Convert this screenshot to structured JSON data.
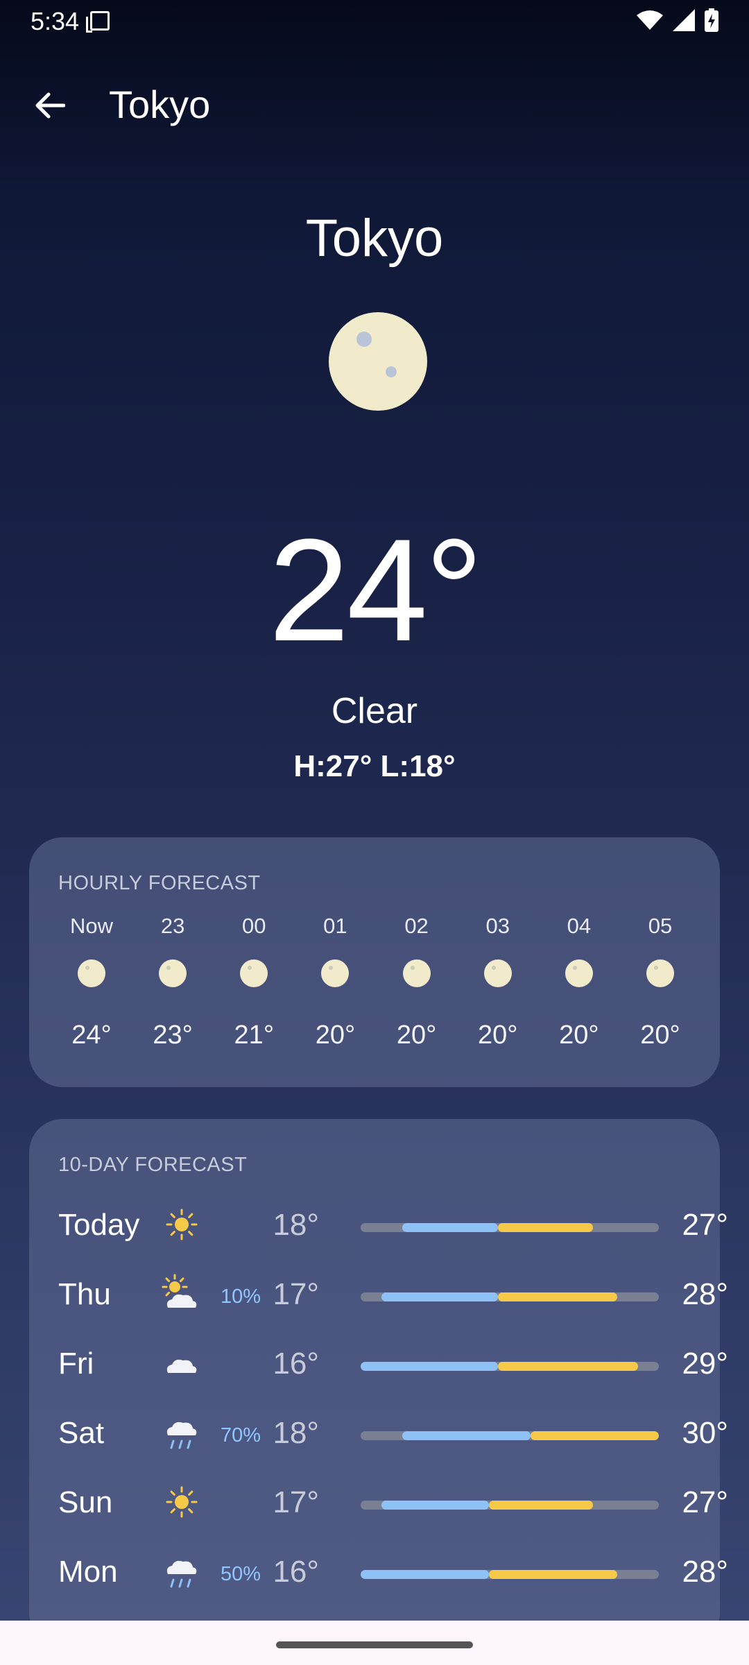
{
  "status_bar": {
    "time": "5:34"
  },
  "app_bar": {
    "title": "Tokyo"
  },
  "current": {
    "city": "Tokyo",
    "temperature": "24°",
    "condition": "Clear",
    "high_low": "H:27° L:18°",
    "icon": "moon-icon"
  },
  "hourly": {
    "title": "HOURLY FORECAST",
    "items": [
      {
        "time": "Now",
        "temp": "24°",
        "icon": "moon-icon"
      },
      {
        "time": "23",
        "temp": "23°",
        "icon": "moon-icon"
      },
      {
        "time": "00",
        "temp": "21°",
        "icon": "moon-icon"
      },
      {
        "time": "01",
        "temp": "20°",
        "icon": "moon-icon"
      },
      {
        "time": "02",
        "temp": "20°",
        "icon": "moon-icon"
      },
      {
        "time": "03",
        "temp": "20°",
        "icon": "moon-icon"
      },
      {
        "time": "04",
        "temp": "20°",
        "icon": "moon-icon"
      },
      {
        "time": "05",
        "temp": "20°",
        "icon": "moon-icon"
      }
    ]
  },
  "daily": {
    "title": "10-DAY FORECAST",
    "items": [
      {
        "day": "Today",
        "icon": "sun-icon",
        "precip": "",
        "low": "18°",
        "high": "27°",
        "range": {
          "start": 0.14,
          "mid": 0.46,
          "end": 0.78
        }
      },
      {
        "day": "Thu",
        "icon": "partly-cloudy-icon",
        "precip": "10%",
        "low": "17°",
        "high": "28°",
        "range": {
          "start": 0.07,
          "mid": 0.46,
          "end": 0.86
        }
      },
      {
        "day": "Fri",
        "icon": "cloud-icon",
        "precip": "",
        "low": "16°",
        "high": "29°",
        "range": {
          "start": 0.0,
          "mid": 0.46,
          "end": 0.93
        }
      },
      {
        "day": "Sat",
        "icon": "rain-icon",
        "precip": "70%",
        "low": "18°",
        "high": "30°",
        "range": {
          "start": 0.14,
          "mid": 0.57,
          "end": 1.0
        }
      },
      {
        "day": "Sun",
        "icon": "sun-icon",
        "precip": "",
        "low": "17°",
        "high": "27°",
        "range": {
          "start": 0.07,
          "mid": 0.43,
          "end": 0.78
        }
      },
      {
        "day": "Mon",
        "icon": "rain-icon",
        "precip": "50%",
        "low": "16°",
        "high": "28°",
        "range": {
          "start": 0.0,
          "mid": 0.43,
          "end": 0.86
        }
      }
    ]
  },
  "colors": {
    "cool": "#8ec2f7",
    "warm": "#f7c948",
    "track": "#7a7f92",
    "moon": "#f2ebcb",
    "precip": "#8fc6ff"
  }
}
